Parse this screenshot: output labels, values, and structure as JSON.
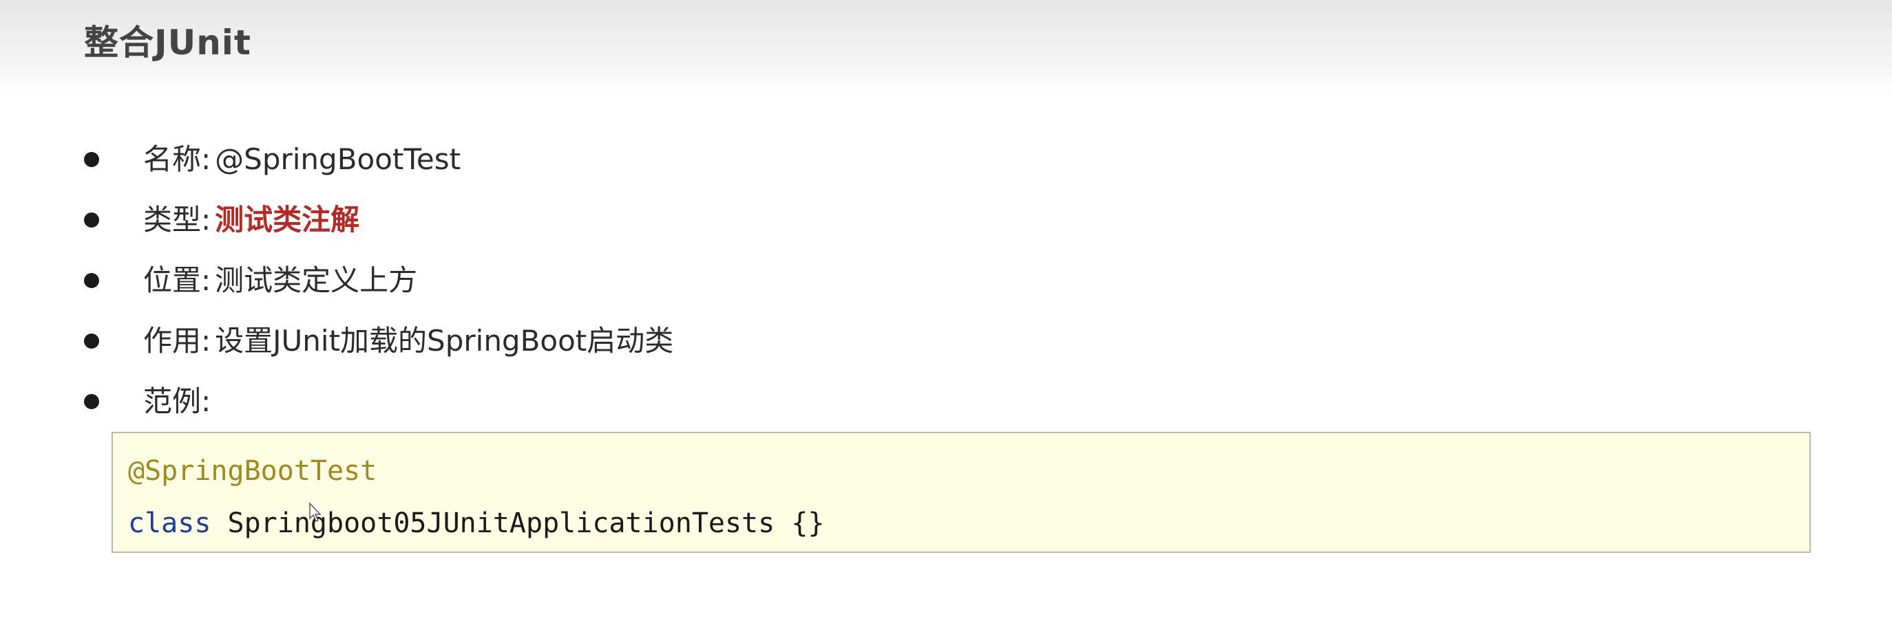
{
  "page": {
    "title": "整合JUnit"
  },
  "bullets": [
    {
      "label": "名称",
      "colon": ":",
      "value": "@SpringBootTest",
      "emphasis": false
    },
    {
      "label": "类型",
      "colon": ":",
      "value": "测试类注解",
      "emphasis": true
    },
    {
      "label": "位置",
      "colon": ":",
      "value": "测试类定义上方",
      "emphasis": false
    },
    {
      "label": "作用",
      "colon": ":",
      "value": "设置JUnit加载的SpringBoot启动类",
      "emphasis": false
    },
    {
      "label": "范例",
      "colon": ":",
      "value": "",
      "emphasis": false
    }
  ],
  "code": {
    "annotation": "@SpringBootTest",
    "keyword": "class",
    "class_name": "Springboot05JUnitApplicationTests",
    "body": "{}"
  },
  "colors": {
    "emphasis": "#b52a24",
    "annotation": "#9e8a1e",
    "keyword": "#1f3b9c",
    "code_background": "#fdfde4"
  },
  "icons": {
    "bullet": "bullet-dot-icon",
    "cursor": "mouse-cursor-icon"
  }
}
